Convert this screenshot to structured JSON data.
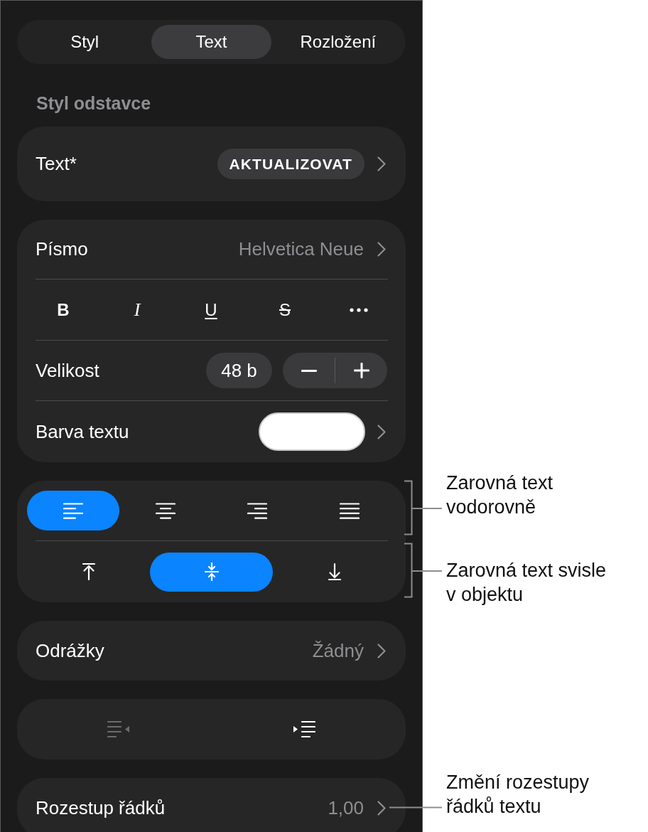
{
  "tabs": [
    {
      "label": "Styl",
      "selected": false
    },
    {
      "label": "Text",
      "selected": true
    },
    {
      "label": "Rozložení",
      "selected": false
    }
  ],
  "section_title": "Styl odstavce",
  "paragraph_style": {
    "label": "Text*",
    "button": "AKTUALIZOVAT"
  },
  "font": {
    "label": "Písmo",
    "value": "Helvetica Neue"
  },
  "text_styles": [
    {
      "kind": "bold",
      "label": "B",
      "selected": false
    },
    {
      "kind": "italic",
      "label": "I",
      "selected": false
    },
    {
      "kind": "underline",
      "label": "U",
      "selected": false
    },
    {
      "kind": "strikethrough",
      "label": "S",
      "selected": false
    },
    {
      "kind": "more"
    }
  ],
  "size": {
    "label": "Velikost",
    "value": "48 b"
  },
  "text_color": {
    "label": "Barva textu",
    "color": "#ffffff"
  },
  "horizontal_alignment": {
    "options": [
      {
        "kind": "left",
        "selected": true
      },
      {
        "kind": "center",
        "selected": false
      },
      {
        "kind": "right",
        "selected": false
      },
      {
        "kind": "justify",
        "selected": false
      }
    ],
    "callout": "Zarovná text\nvodorovně"
  },
  "vertical_alignment": {
    "options": [
      {
        "kind": "top",
        "selected": false
      },
      {
        "kind": "middle",
        "selected": true
      },
      {
        "kind": "bottom",
        "selected": false
      }
    ],
    "callout": "Zarovná text svisle\nv objektu"
  },
  "bullets": {
    "label": "Odrážky",
    "value": "Žádný"
  },
  "indent": [
    {
      "kind": "decrease",
      "disabled": true
    },
    {
      "kind": "increase",
      "disabled": false
    }
  ],
  "line_spacing": {
    "label": "Rozestup řádků",
    "value": "1,00",
    "callout": "Změní rozestupy\nřádků textu"
  }
}
